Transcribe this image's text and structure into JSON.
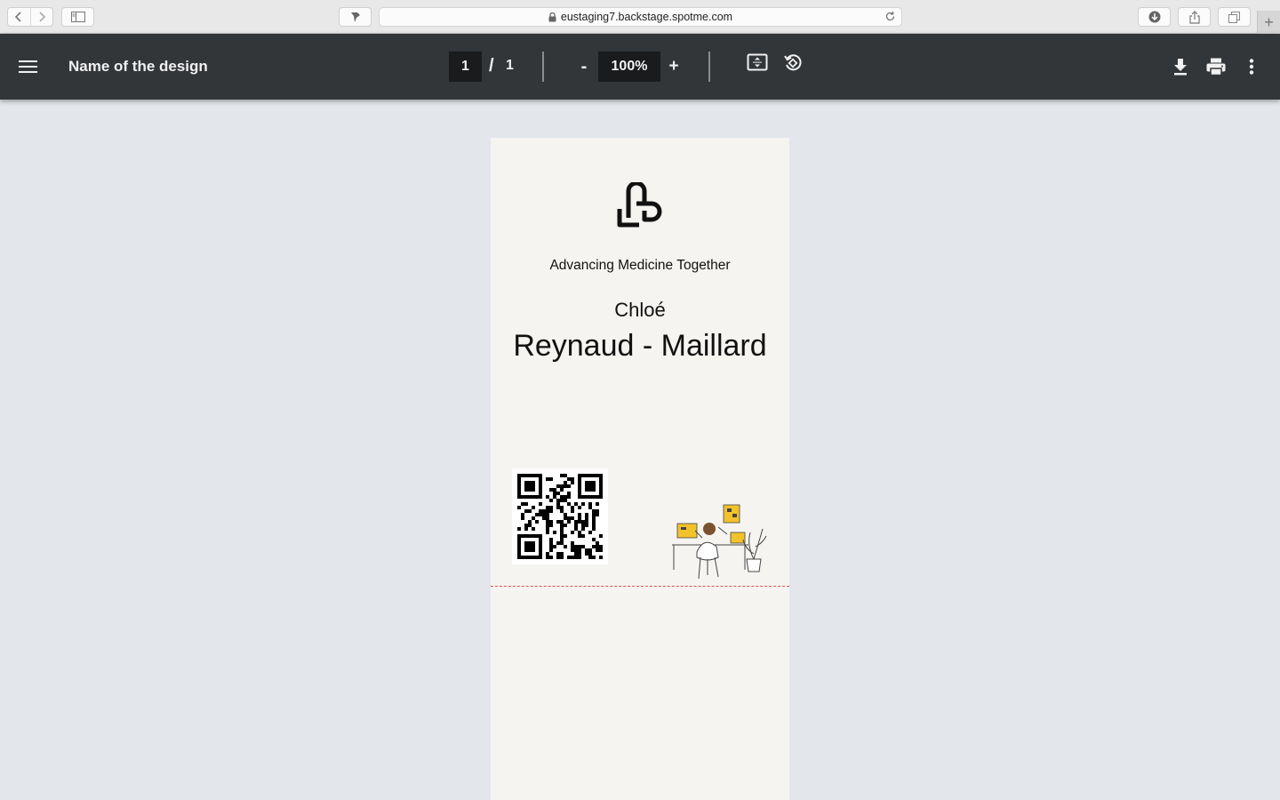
{
  "browser": {
    "url": "eustaging7.backstage.spotme.com",
    "new_tab_label": "+"
  },
  "toolbar": {
    "title": "Name of the design",
    "page_current": "1",
    "page_separator": "/",
    "page_total": "1",
    "zoom_out_label": "-",
    "zoom_value": "100%",
    "zoom_in_label": "+",
    "icons": [
      "menu-icon",
      "fit-page-icon",
      "rotate-icon",
      "download-icon",
      "print-icon",
      "more-icon"
    ]
  },
  "document": {
    "tagline": "Advancing Medicine Together",
    "first_name": "Chloé",
    "last_name": "Reynaud - Maillard",
    "illustration_accent": "#f2c22b",
    "cut_line_color": "#d9534f"
  }
}
